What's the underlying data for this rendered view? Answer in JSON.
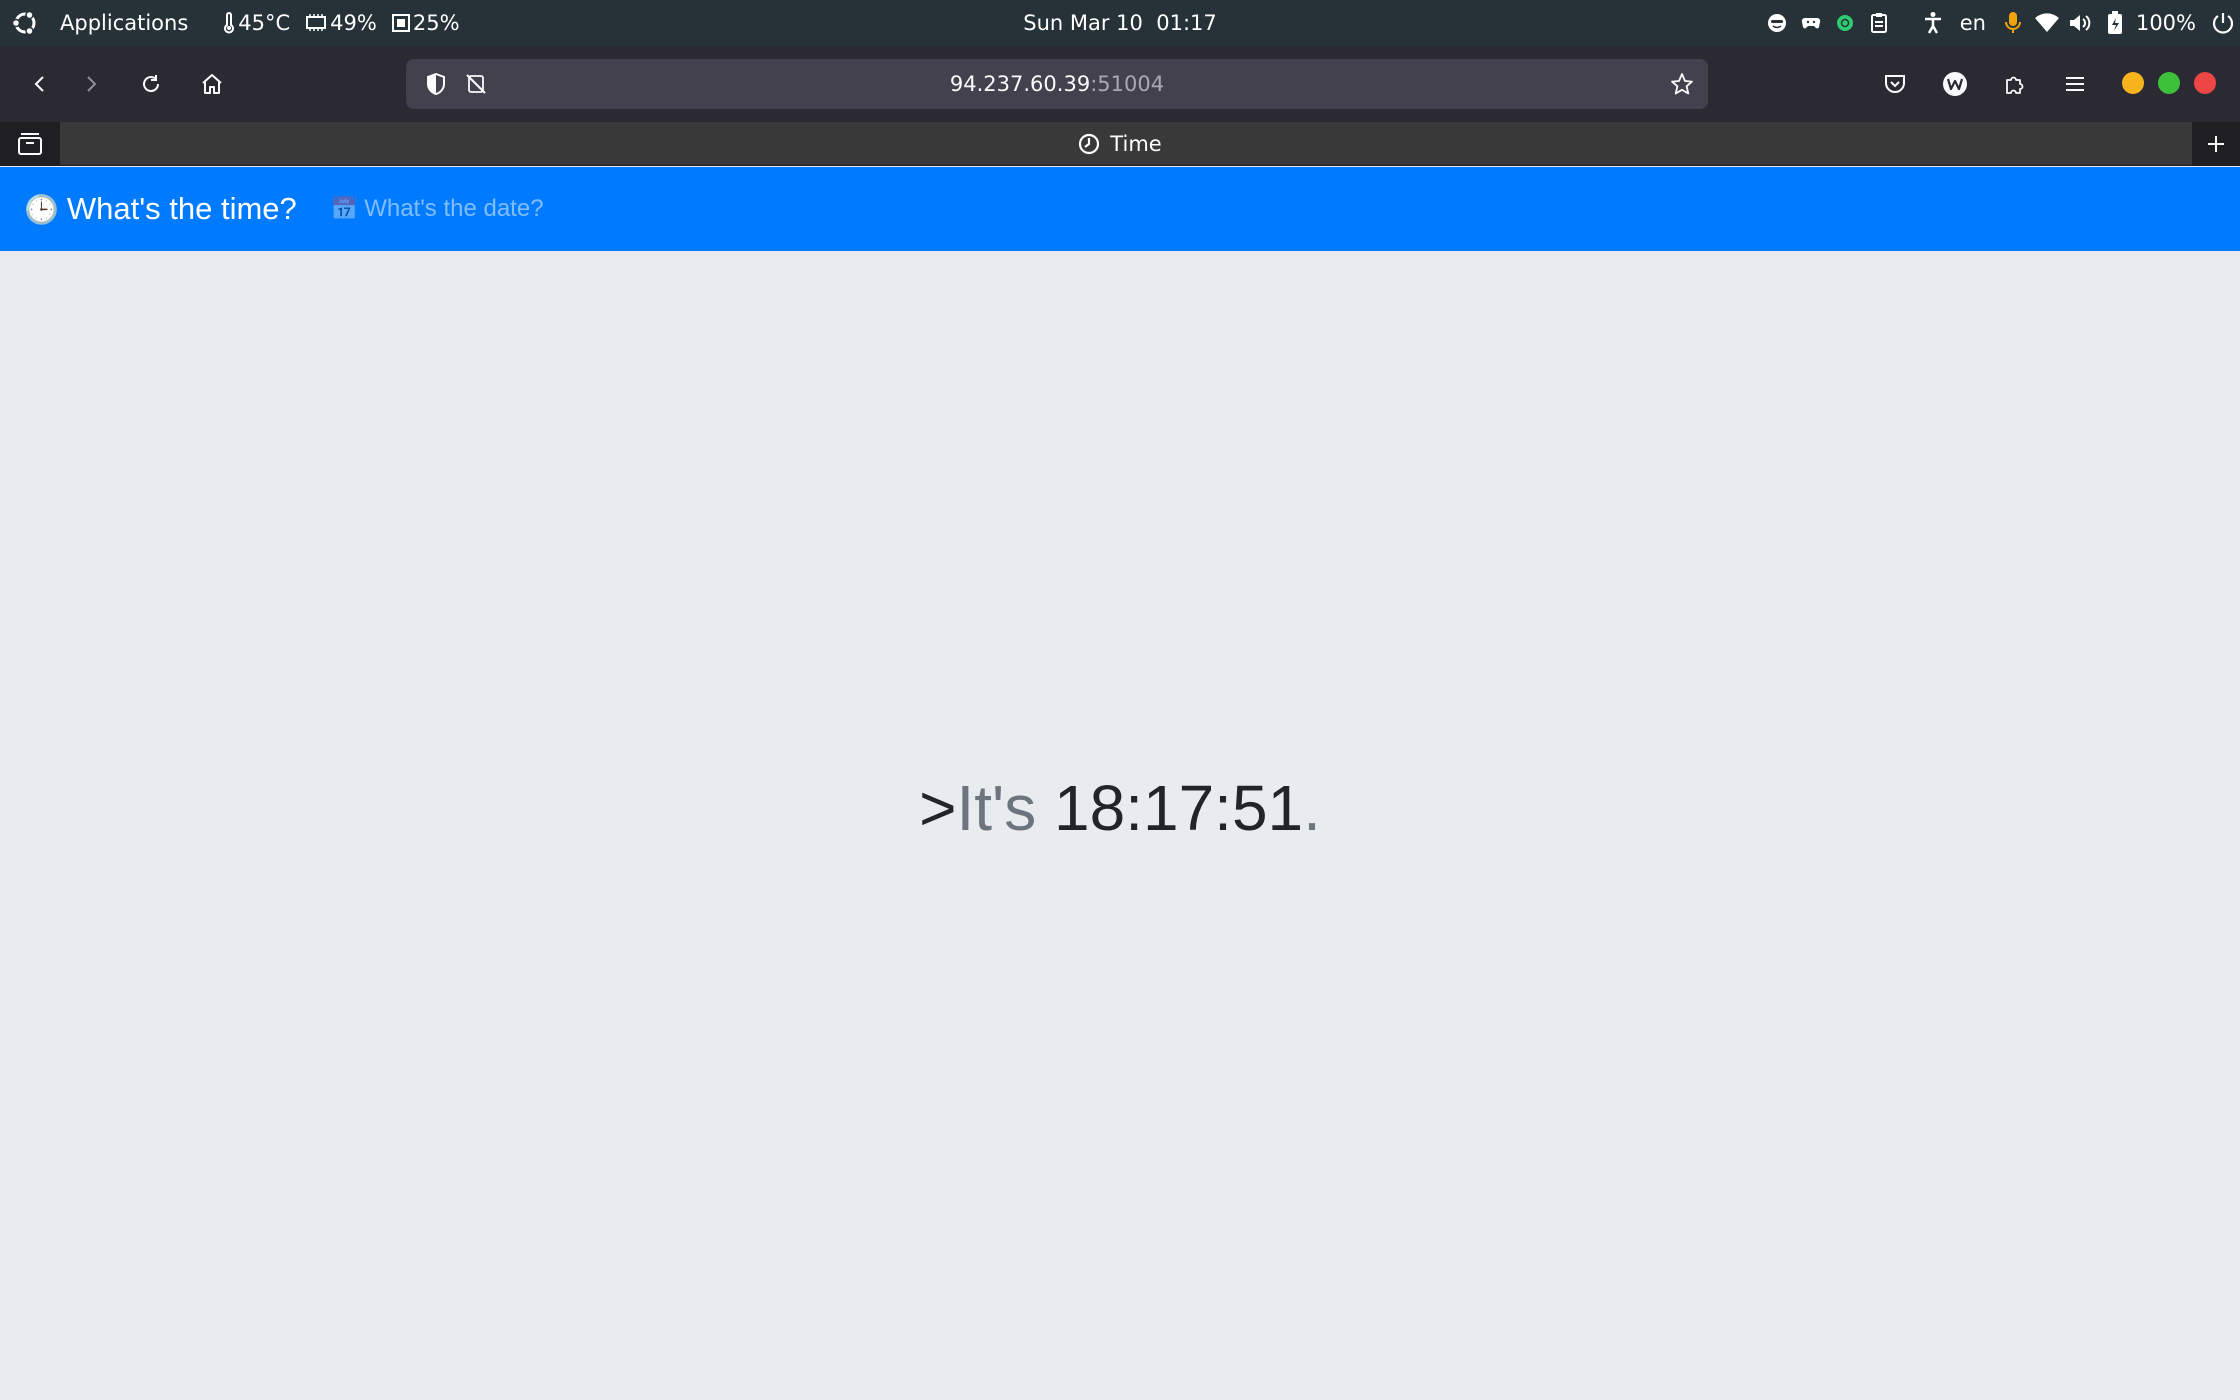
{
  "os_panel": {
    "apps_label": "Applications",
    "temperature": "45°C",
    "cpu": "49%",
    "memory": "25%",
    "clock": "Sun Mar 10  01:17",
    "language": "en",
    "battery": "100%"
  },
  "browser": {
    "url_host": "94.237.60.39",
    "url_port": ":51004",
    "tab_title": "Time",
    "window_controls": {
      "minimize_color": "#f6b31b",
      "maximize_color": "#3ec13a",
      "close_color": "#ee4545"
    }
  },
  "page": {
    "brand_icon": "🕒",
    "brand_label": "What's the time?",
    "date_link_icon": "📅",
    "date_link_label": "What's the date?",
    "prefix": ">",
    "its_label": "It's ",
    "time_value": "18:17:51",
    "period": ".",
    "accent_color": "#007bff"
  }
}
